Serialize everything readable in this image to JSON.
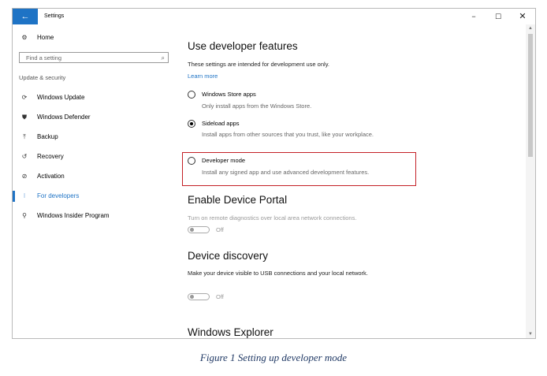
{
  "window": {
    "title": "Settings",
    "back_icon": "←",
    "minimize_icon": "−",
    "maximize_icon": "☐",
    "close_icon": "✕"
  },
  "sidebar": {
    "home_label": "Home",
    "home_icon": "⚙",
    "search_placeholder": "Find a setting",
    "search_icon": "⌕",
    "section_label": "Update & security",
    "items": [
      {
        "label": "Windows Update",
        "icon": "⟳",
        "active": false
      },
      {
        "label": "Windows Defender",
        "icon": "⛊",
        "active": false
      },
      {
        "label": "Backup",
        "icon": "⤒",
        "active": false
      },
      {
        "label": "Recovery",
        "icon": "↺",
        "active": false
      },
      {
        "label": "Activation",
        "icon": "⊘",
        "active": false
      },
      {
        "label": "For developers",
        "icon": "⁝",
        "active": true
      },
      {
        "label": "Windows Insider Program",
        "icon": "⚲",
        "active": false
      }
    ]
  },
  "content": {
    "dev_features_title": "Use developer features",
    "dev_features_desc": "These settings are intended for development use only.",
    "learn_more": "Learn more",
    "options": [
      {
        "label": "Windows Store apps",
        "desc": "Only install apps from the Windows Store.",
        "checked": false
      },
      {
        "label": "Sideload apps",
        "desc": "Install apps from other sources that you trust, like your workplace.",
        "checked": true
      },
      {
        "label": "Developer mode",
        "desc": "Install any signed app and use advanced development features.",
        "checked": false
      }
    ],
    "device_portal_title": "Enable Device Portal",
    "device_portal_desc": "Turn on remote diagnostics over local area network connections.",
    "device_portal_toggle": "Off",
    "device_discovery_title": "Device discovery",
    "device_discovery_desc": "Make your device visible to USB connections and your local network.",
    "device_discovery_toggle": "Off",
    "explorer_title": "Windows Explorer"
  },
  "caption": "Figure 1 Setting up developer mode",
  "colors": {
    "accent": "#1e73c5",
    "highlight_border": "#c42026",
    "caption": "#1f3864"
  }
}
